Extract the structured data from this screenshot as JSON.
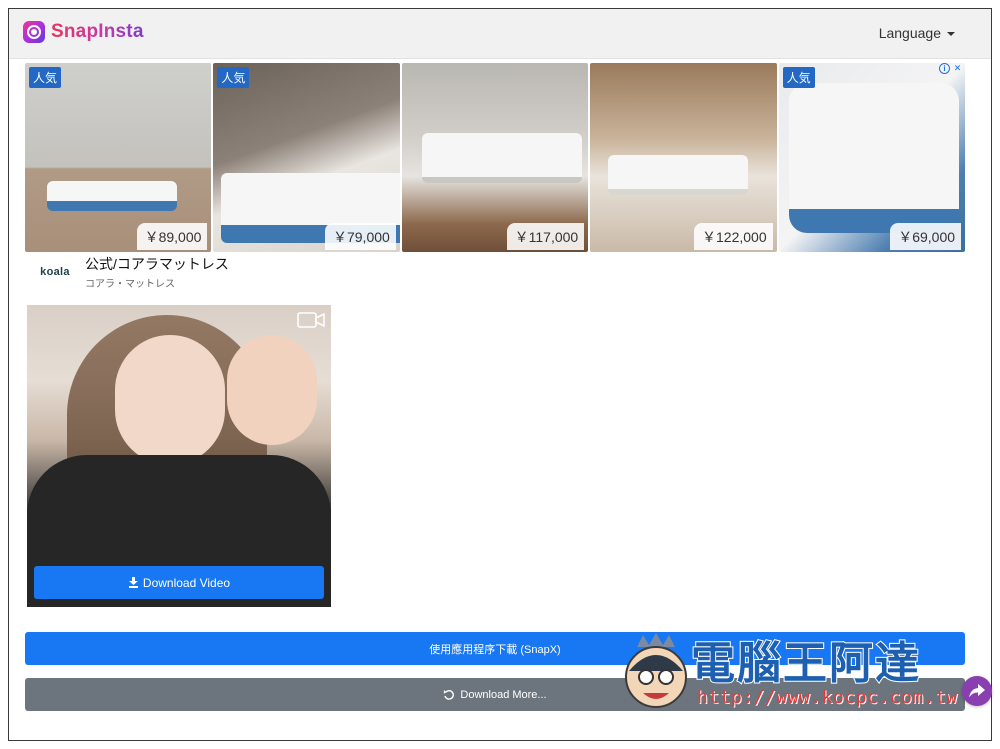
{
  "navbar": {
    "brand": "SnapInsta",
    "language_label": "Language"
  },
  "ad": {
    "tiles": [
      {
        "badge": "人気",
        "price": "￥89,000"
      },
      {
        "badge": "人気",
        "price": "￥79,000"
      },
      {
        "badge": "",
        "price": "￥117,000"
      },
      {
        "badge": "",
        "price": "￥122,000"
      },
      {
        "badge": "人気",
        "price": "￥69,000"
      }
    ],
    "advertiser_logo": "koala",
    "title": "公式/コアラマットレス",
    "subtitle": "コアラ・マットレス"
  },
  "video": {
    "download_label": "Download Video"
  },
  "buttons": {
    "app_download": "使用應用程序下載 (SnapX)",
    "download_more": "Download More..."
  },
  "watermark": {
    "title": "電腦王阿達",
    "url": "http://www.kocpc.com.tw"
  },
  "colors": {
    "primary": "#1877f2",
    "secondary": "#6c757d",
    "share": "#8a3fb0",
    "ad_badge": "#2268c4"
  }
}
